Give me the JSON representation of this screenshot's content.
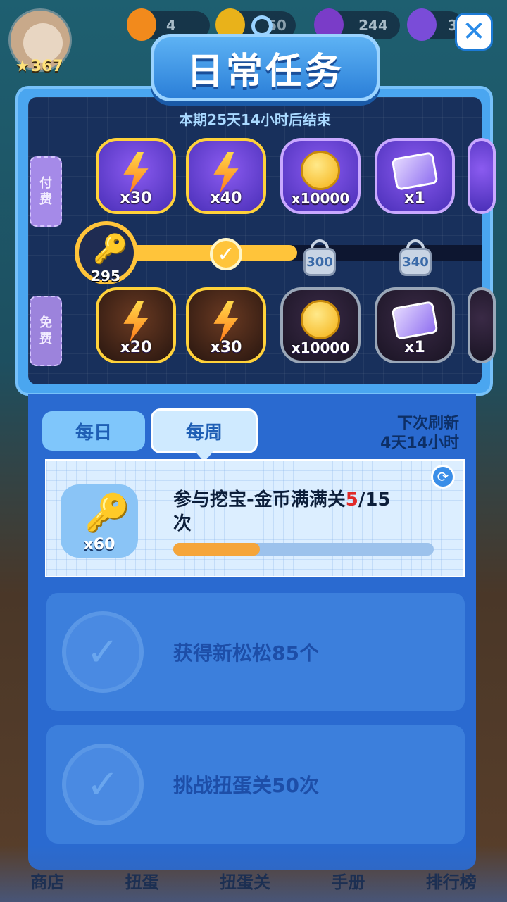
{
  "hud": {
    "level": "367",
    "energy": "4",
    "coins": "50",
    "gems": "244",
    "crowns": "3"
  },
  "title": "日常任务",
  "period_text": "本期25天14小时后结束",
  "tracks": {
    "paid_label_1": "付",
    "paid_label_2": "费",
    "free_label_1": "免",
    "free_label_2": "费"
  },
  "progress": {
    "current_keys": "295",
    "milestone_300": "300",
    "milestone_340": "340",
    "fill_fraction": 0.5
  },
  "paid_rewards": [
    {
      "qty": "x30",
      "icon": "energy-bolt-icon"
    },
    {
      "qty": "x40",
      "icon": "energy-bolt-icon"
    },
    {
      "qty": "x10000",
      "icon": "mouse-coin-icon"
    },
    {
      "qty": "x1",
      "icon": "ticket-card-icon"
    }
  ],
  "free_rewards": [
    {
      "qty": "x20",
      "icon": "energy-bolt-icon"
    },
    {
      "qty": "x30",
      "icon": "energy-bolt-icon"
    },
    {
      "qty": "x10000",
      "icon": "mouse-coin-icon"
    },
    {
      "qty": "x1",
      "icon": "ticket-card-icon"
    }
  ],
  "tabs": {
    "daily": "每日",
    "weekly": "每周"
  },
  "refresh": {
    "line1": "下次刷新",
    "line2": "4天14小时"
  },
  "tasks": [
    {
      "reward_qty": "x60",
      "text_before": "参与挖宝-金币满满关",
      "current": "5",
      "total": "/15",
      "text_after": "次",
      "progress": 0.333
    },
    {
      "text": "获得新松松85个"
    },
    {
      "text": "挑战扭蛋关50次"
    }
  ],
  "bottom_nav": [
    "商店",
    "扭蛋",
    "扭蛋关",
    "手册",
    "排行榜"
  ],
  "colors": {
    "accent": "#ffc43a",
    "panel": "#2a6ad0",
    "highlight": "#e02a2a"
  }
}
